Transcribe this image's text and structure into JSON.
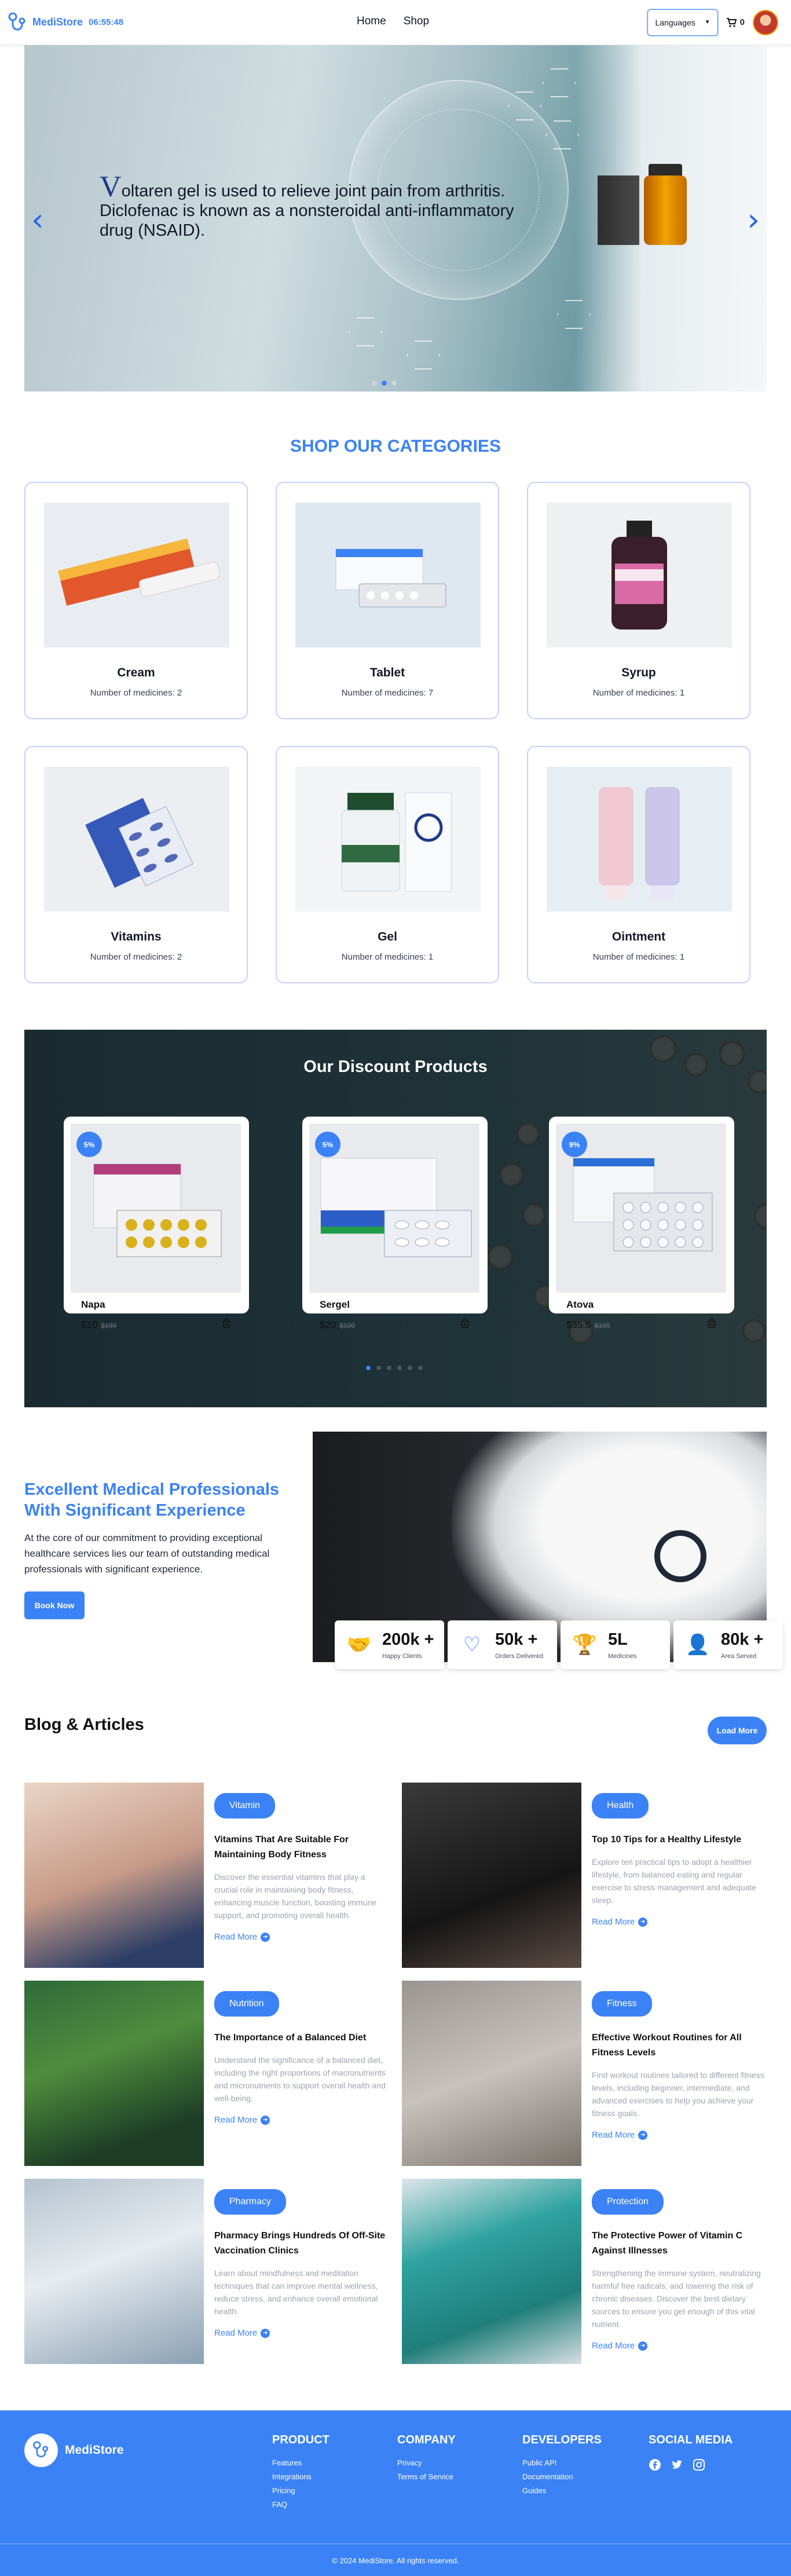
{
  "nav": {
    "brand": "MediStore",
    "time": "06:55:48",
    "links": [
      "Home",
      "Shop"
    ],
    "language": "Languages",
    "cart_count": "0"
  },
  "hero": {
    "first_letter": "V",
    "text": "oltaren gel is used to relieve joint pain from arthritis. Diclofenac is known as a nonsteroidal anti-inflammatory drug (NSAID).",
    "arrow_left": "‹",
    "arrow_right": "›",
    "slides": 3,
    "active_slide": 2
  },
  "categories": {
    "title": "SHOP OUR CATEGORIES",
    "items": [
      {
        "name": "Cream",
        "count": "Number of medicines: 2"
      },
      {
        "name": "Tablet",
        "count": "Number of medicines: 7"
      },
      {
        "name": "Syrup",
        "count": "Number of medicines: 1"
      },
      {
        "name": "Vitamins",
        "count": "Number of medicines: 2"
      },
      {
        "name": "Gel",
        "count": "Number of medicines: 1"
      },
      {
        "name": "Ointment",
        "count": "Number of medicines: 1"
      }
    ]
  },
  "discount": {
    "title": "Our Discount Products",
    "items": [
      {
        "badge": "5%",
        "name": "Napa",
        "price": "$10",
        "old": "$199"
      },
      {
        "badge": "5%",
        "name": "Sergel",
        "price": "$20",
        "old": "$199"
      },
      {
        "badge": "9%",
        "name": "Atova",
        "price": "$35.5",
        "old": "$199"
      }
    ]
  },
  "professionals": {
    "title": "Excellent Medical Professionals With Significant Experience",
    "desc": "At the core of our commitment to providing exceptional healthcare services lies our team of outstanding medical professionals with significant experience.",
    "button": "Book Now",
    "stats": [
      {
        "icon": "handshake-icon",
        "value": "200k +",
        "label": "Happy Clients"
      },
      {
        "icon": "heart-icon",
        "value": "50k +",
        "label": "Orders Delivered"
      },
      {
        "icon": "trophy-icon",
        "value": "5L",
        "label": "Medicines"
      },
      {
        "icon": "user-plus-icon",
        "value": "80k +",
        "label": "Area Served"
      }
    ]
  },
  "blog": {
    "title": "Blog & Articles",
    "more": "Load More",
    "read_more": "Read More",
    "posts": [
      {
        "tag": "Vitamin",
        "title": "Vitamins That Are Suitable For Maintaining Body Fitness",
        "excerpt": "Discover the essential vitamins that play a crucial role in maintaining body fitness, enhancing muscle function, boosting immune support, and promoting overall health."
      },
      {
        "tag": "Health",
        "title": "Top 10 Tips for a Healthy Lifestyle",
        "excerpt": "Explore ten practical tips to adopt a healthier lifestyle, from balanced eating and regular exercise to stress management and adequate sleep."
      },
      {
        "tag": "Nutrition",
        "title": "The Importance of a Balanced Diet",
        "excerpt": "Understand the significance of a balanced diet, including the right proportions of macronutrients and micronutrients to support overall health and well-being."
      },
      {
        "tag": "Fitness",
        "title": "Effective Workout Routines for All Fitness Levels",
        "excerpt": "Find workout routines tailored to different fitness levels, including beginner, intermediate, and advanced exercises to help you achieve your fitness goals."
      },
      {
        "tag": "Pharmacy",
        "title": "Pharmacy Brings Hundreds Of Off-Site Vaccination Clinics",
        "excerpt": "Learn about mindfulness and meditation techniques that can improve mental wellness, reduce stress, and enhance overall emotional health."
      },
      {
        "tag": "Protection",
        "title": "The Protective Power of Vitamin C Against Illnesses",
        "excerpt": "Strengthening the immune system, neutralizing harmful free radicals, and lowering the risk of chronic diseases. Discover the best dietary sources to ensure you get enough of this vital nutrient."
      }
    ]
  },
  "footer": {
    "brand": "MediStore",
    "columns": [
      {
        "title": "PRODUCT",
        "links": [
          "Features",
          "Integrations",
          "Pricing",
          "FAQ"
        ]
      },
      {
        "title": "COMPANY",
        "links": [
          "Privacy",
          "Terms of Service"
        ]
      },
      {
        "title": "DEVELOPERS",
        "links": [
          "Public API",
          "Documentation",
          "Guides"
        ]
      }
    ],
    "social_title": "SOCIAL MEDIA",
    "copyright": "© 2024 MediStore. All rights reserved."
  },
  "colors": {
    "accent": "#3b82f6",
    "dark": "#1e3338",
    "footer": "#3b82f6"
  }
}
